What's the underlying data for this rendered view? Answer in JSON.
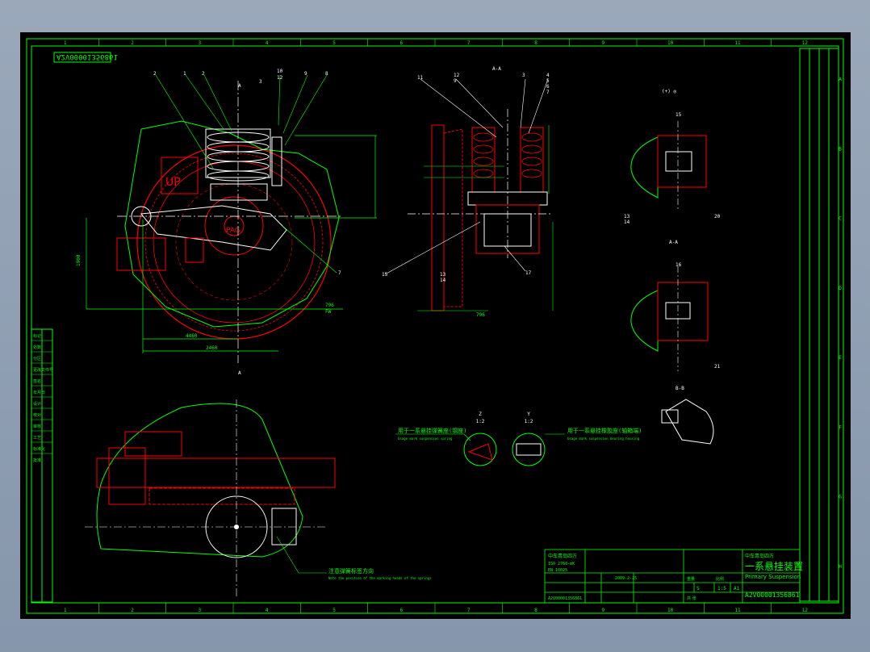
{
  "drawing": {
    "border_cols": [
      "1",
      "2",
      "3",
      "4",
      "5",
      "6",
      "7",
      "8",
      "9",
      "10",
      "11",
      "12"
    ],
    "border_rows": [
      "A",
      "B",
      "C",
      "D",
      "E",
      "F",
      "G",
      "H"
    ],
    "mirror_code": "A2V00001356861",
    "section_aa": "A-A",
    "view_label": "B-B",
    "section_label_mid": "A-A",
    "balloons_main": [
      "2",
      "1",
      "2",
      "3",
      "10",
      "12",
      "9",
      "8",
      "7"
    ],
    "balloons_section": [
      "11",
      "12",
      "9",
      "3",
      "4",
      "5",
      "6",
      "7",
      "13",
      "14",
      "15",
      "17"
    ],
    "balloons_right": [
      "15",
      "16",
      "13",
      "14",
      "20",
      "21"
    ],
    "dim_labels": [
      "4460",
      "1900",
      "2460",
      "796",
      "FW"
    ],
    "detail_marks": [
      {
        "id": "Z",
        "scale": "1:2"
      },
      {
        "id": "Y",
        "scale": "1:2"
      }
    ],
    "note_left": "用于一系悬挂弹簧座(钢座)",
    "note_left_en": "Usage mark suspension spring",
    "note_right": "用于一系悬挂橡胶座(轴箱端)",
    "note_right_en": "Usage mark suspension bearing housing",
    "note_bottom": "注意弹簧标签方向",
    "note_bottom_en": "Note the position of the marking heads of the springs",
    "left_table_rows": [
      "标记",
      "处数",
      "分区",
      "更改文件号",
      "签名",
      "年月日",
      "设计",
      "校对",
      "审核",
      "工艺",
      "标准化",
      "批准"
    ]
  },
  "title_block": {
    "title_cn": "一系悬挂装置",
    "title_en": "Primary Suspension",
    "drawing_no": "A2V00001356861",
    "company": "中车青岛四方",
    "std": "ISO 2768-mK",
    "material": "EN 10025",
    "date": "2009-2-25",
    "scale": "1:5",
    "sheet_size": "A1",
    "weight_label": "重量",
    "scale_label": "比例",
    "sheet_label": "共 张",
    "ref_no": "A2V00001356861",
    "stage": "S",
    "page": "1"
  },
  "colors": {
    "outline": "#00ff00",
    "parts": "#ff0000",
    "centerline": "#ffffff",
    "dims": "#00ff00",
    "leaders": "#ffffff"
  }
}
